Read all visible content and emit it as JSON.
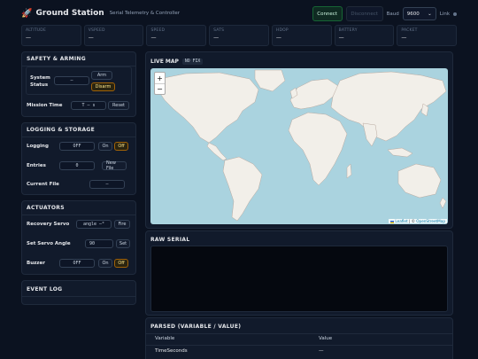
{
  "header": {
    "logo_icon": "rocket-icon",
    "title": "Ground Station",
    "subtitle": "Serial Telemetry & Controller",
    "connect_label": "Connect",
    "disconnect_label": "Disconnect",
    "baud_label": "Baud",
    "baud_value": "9600",
    "link_label": "Link"
  },
  "telemetry": [
    {
      "key": "ALTITUDE",
      "value": "—"
    },
    {
      "key": "VSPEED",
      "value": "—"
    },
    {
      "key": "SPEED",
      "value": "—"
    },
    {
      "key": "SATS",
      "value": "—"
    },
    {
      "key": "HDOP",
      "value": "—"
    },
    {
      "key": "BATTERY",
      "value": "—"
    },
    {
      "key": "PACKET",
      "value": "—"
    }
  ],
  "safety": {
    "title": "SAFETY & ARMING",
    "system_status_label": "System Status",
    "system_status_value": "—",
    "arm_label": "Arm",
    "disarm_label": "Disarm",
    "mission_time_label": "Mission Time",
    "mission_time_value": "T — s",
    "reset_label": "Reset"
  },
  "logging": {
    "title": "LOGGING & STORAGE",
    "logging_label": "Logging",
    "logging_value": "OFF",
    "on_label": "On",
    "off_label": "Off",
    "entries_label": "Entries",
    "entries_value": "0",
    "new_file_label": "New File",
    "current_file_label": "Current File",
    "current_file_value": "—"
  },
  "actuators": {
    "title": "ACTUATORS",
    "recovery_servo_label": "Recovery Servo",
    "recovery_servo_value": "angle —°",
    "fire_label": "Fire",
    "set_servo_label": "Set Servo Angle",
    "servo_angle_value": "90",
    "set_label": "Set",
    "buzzer_label": "Buzzer",
    "buzzer_value": "OFF",
    "on_label": "On",
    "off_label": "Off"
  },
  "event_log": {
    "title": "EVENT LOG"
  },
  "map": {
    "title": "LIVE MAP",
    "fix_badge": "NO FIX",
    "zoom_in": "+",
    "zoom_out": "−",
    "attrib_leaflet": "Leaflet",
    "attrib_sep": " | © ",
    "attrib_osm": "OpenStreetMap"
  },
  "raw_serial": {
    "title": "RAW SERIAL"
  },
  "parsed": {
    "title": "PARSED (VARIABLE / VALUE)",
    "col_variable": "Variable",
    "col_value": "Value",
    "rows": [
      {
        "variable": "TimeSeconds",
        "value": "—"
      }
    ]
  },
  "colors": {
    "background": "#0b1220",
    "panel": "#111a2b",
    "accent_amber": "#a16207",
    "connect_green": "#166534",
    "map_water": "#aad3df",
    "map_land": "#f2efe9"
  }
}
